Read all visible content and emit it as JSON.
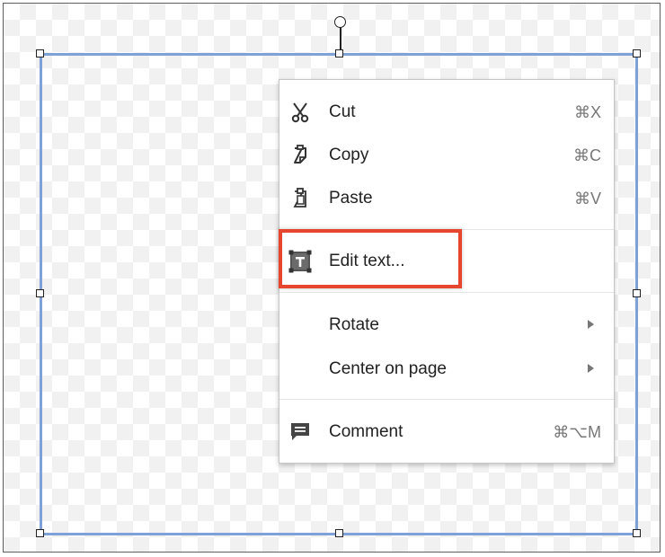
{
  "colors": {
    "selection_border": "#7ea1d8",
    "highlight_border": "#e6452e"
  },
  "context_menu": {
    "items": [
      {
        "label": "Cut",
        "shortcut": "⌘X",
        "icon": "scissors-icon"
      },
      {
        "label": "Copy",
        "shortcut": "⌘C",
        "icon": "copy-icon"
      },
      {
        "label": "Paste",
        "shortcut": "⌘V",
        "icon": "paste-icon"
      },
      {
        "label": "Edit text...",
        "shortcut": "",
        "icon": "text-box-icon"
      },
      {
        "label": "Rotate",
        "shortcut": "",
        "icon": "",
        "submenu": true
      },
      {
        "label": "Center on page",
        "shortcut": "",
        "icon": "",
        "submenu": true
      },
      {
        "label": "Comment",
        "shortcut": "⌘⌥M",
        "icon": "comment-icon"
      }
    ]
  }
}
